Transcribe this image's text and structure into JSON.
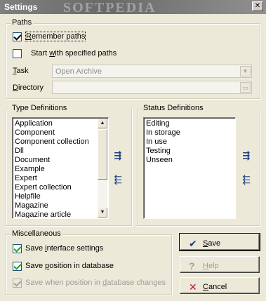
{
  "window": {
    "title": "Settings",
    "watermark": "SOFTPEDIA",
    "close_glyph": "✕"
  },
  "paths": {
    "legend": "Paths",
    "remember": {
      "pre": "",
      "accel": "R",
      "post": "emember paths",
      "checked": true
    },
    "start_specified": {
      "pre": "Start ",
      "accel": "w",
      "post": "ith specified paths",
      "checked": false
    },
    "task_label": {
      "accel": "T",
      "post": "ask"
    },
    "task_value": "Open Archive",
    "directory_label": {
      "accel": "D",
      "post": "irectory"
    },
    "directory_value": "",
    "directory_button_icon": "folder-icon"
  },
  "type_definitions": {
    "legend": "Type Definitions",
    "items": [
      "Application",
      "Component",
      "Component collection",
      "Dll",
      "Document",
      "Example",
      "Expert",
      "Expert collection",
      "Helpfile",
      "Magazine",
      "Magazine article"
    ]
  },
  "status_definitions": {
    "legend": "Status Definitions",
    "items": [
      "Editing",
      "In storage",
      "In use",
      "Testing",
      "Unseen"
    ]
  },
  "misc": {
    "legend": "Miscellaneous",
    "save_interface": {
      "pre": "Save ",
      "accel": "i",
      "post": "nterface settings",
      "checked": true
    },
    "save_position": {
      "pre": "Save ",
      "accel": "p",
      "post": "osition in database",
      "checked": true
    },
    "save_when_changes": {
      "pre": "Save when position in ",
      "accel": "d",
      "post": "atabase changes",
      "checked": true,
      "disabled": true
    }
  },
  "buttons": {
    "save": {
      "accel": "S",
      "post": "ave",
      "icon": "✔"
    },
    "help": {
      "accel": "H",
      "post": "elp",
      "icon": "?"
    },
    "cancel": {
      "accel": "C",
      "post": "ancel",
      "icon": "✕"
    }
  },
  "colors": {
    "face": "#ece9d8",
    "check_green": "#21a121",
    "arrow_blue": "#1d3c8a",
    "cancel_red": "#c8102e",
    "save_blue": "#1b3a9a"
  }
}
